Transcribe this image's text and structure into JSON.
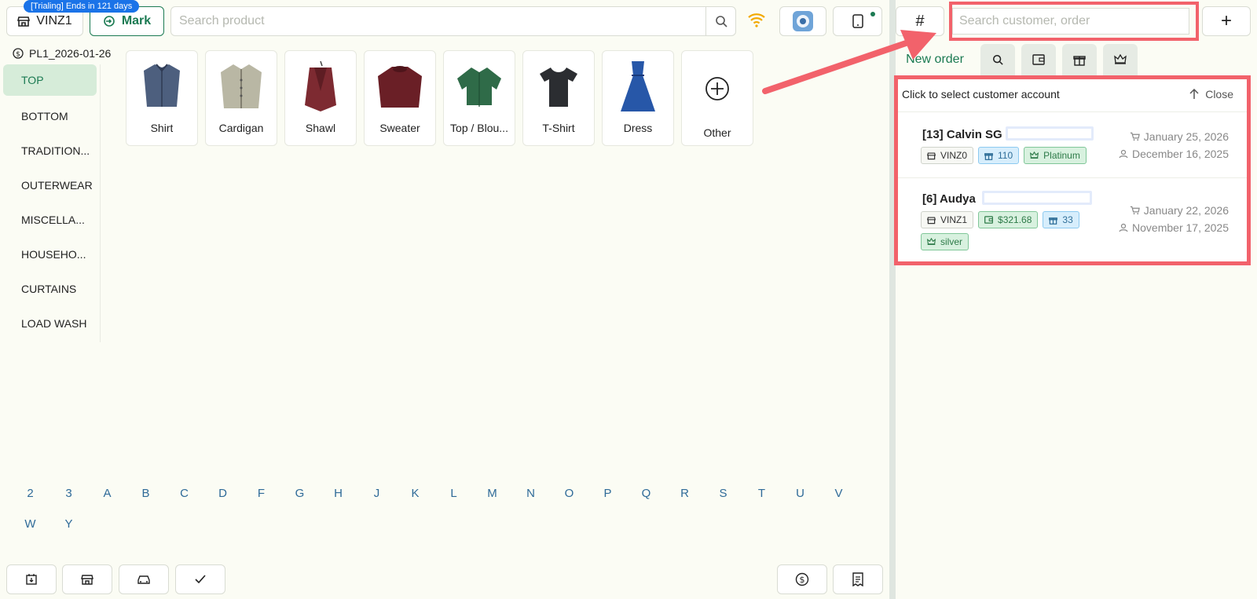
{
  "header": {
    "trial_badge": "[Trialing] Ends in 121 days",
    "store": "VINZ1",
    "mark_label": "Mark",
    "search_placeholder": "Search product"
  },
  "pricelist": "PL1_2026-01-26",
  "categories": [
    "TOP",
    "BOTTOM",
    "TRADITION...",
    "OUTERWEAR",
    "MISCELLA...",
    "HOUSEHO...",
    "CURTAINS",
    "LOAD WASH"
  ],
  "products": [
    "Shirt",
    "Cardigan",
    "Shawl",
    "Sweater",
    "Top / Blou...",
    "T-Shirt",
    "Dress",
    "Other"
  ],
  "alphabet": [
    "2",
    "3",
    "A",
    "B",
    "C",
    "D",
    "F",
    "G",
    "H",
    "J",
    "K",
    "L",
    "M",
    "N",
    "O",
    "P",
    "Q",
    "R",
    "S",
    "T",
    "U",
    "V",
    "W",
    "Y"
  ],
  "right": {
    "hash": "#",
    "search_placeholder": "Search customer, order",
    "plus": "+",
    "tab_new_order": "New order",
    "panel_title": "Click to select customer account",
    "close_label": "Close",
    "customers": [
      {
        "id": "[13]",
        "name": "Calvin SG",
        "store": "VINZ0",
        "points": "110",
        "tier": "Platinum",
        "last_order": "January 25, 2026",
        "created": "December 16, 2025"
      },
      {
        "id": "[6]",
        "name": "Audya",
        "store": "VINZ1",
        "wallet": "$321.68",
        "points": "33",
        "tier": "silver",
        "last_order": "January 22, 2026",
        "created": "November 17, 2025"
      }
    ]
  },
  "colors": {
    "accent": "#1b7a52",
    "highlight": "#f2626b",
    "trial": "#1a73e8"
  }
}
